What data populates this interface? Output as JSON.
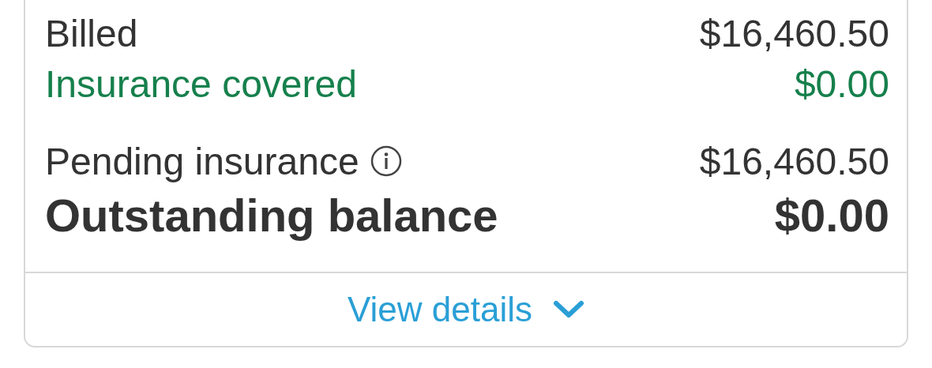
{
  "summary_groups": [
    {
      "rows": [
        {
          "kind": "plain",
          "label": "Billed",
          "amount": "$16,460.50",
          "info": false
        },
        {
          "kind": "covered",
          "label": "Insurance covered",
          "amount": "$0.00",
          "info": false
        }
      ]
    },
    {
      "rows": [
        {
          "kind": "plain",
          "label": "Pending insurance",
          "amount": "$16,460.50",
          "info": true
        },
        {
          "kind": "total",
          "label": "Outstanding balance",
          "amount": "$0.00",
          "info": false
        }
      ]
    }
  ],
  "details_link": {
    "label": "View details",
    "expanded": false
  }
}
